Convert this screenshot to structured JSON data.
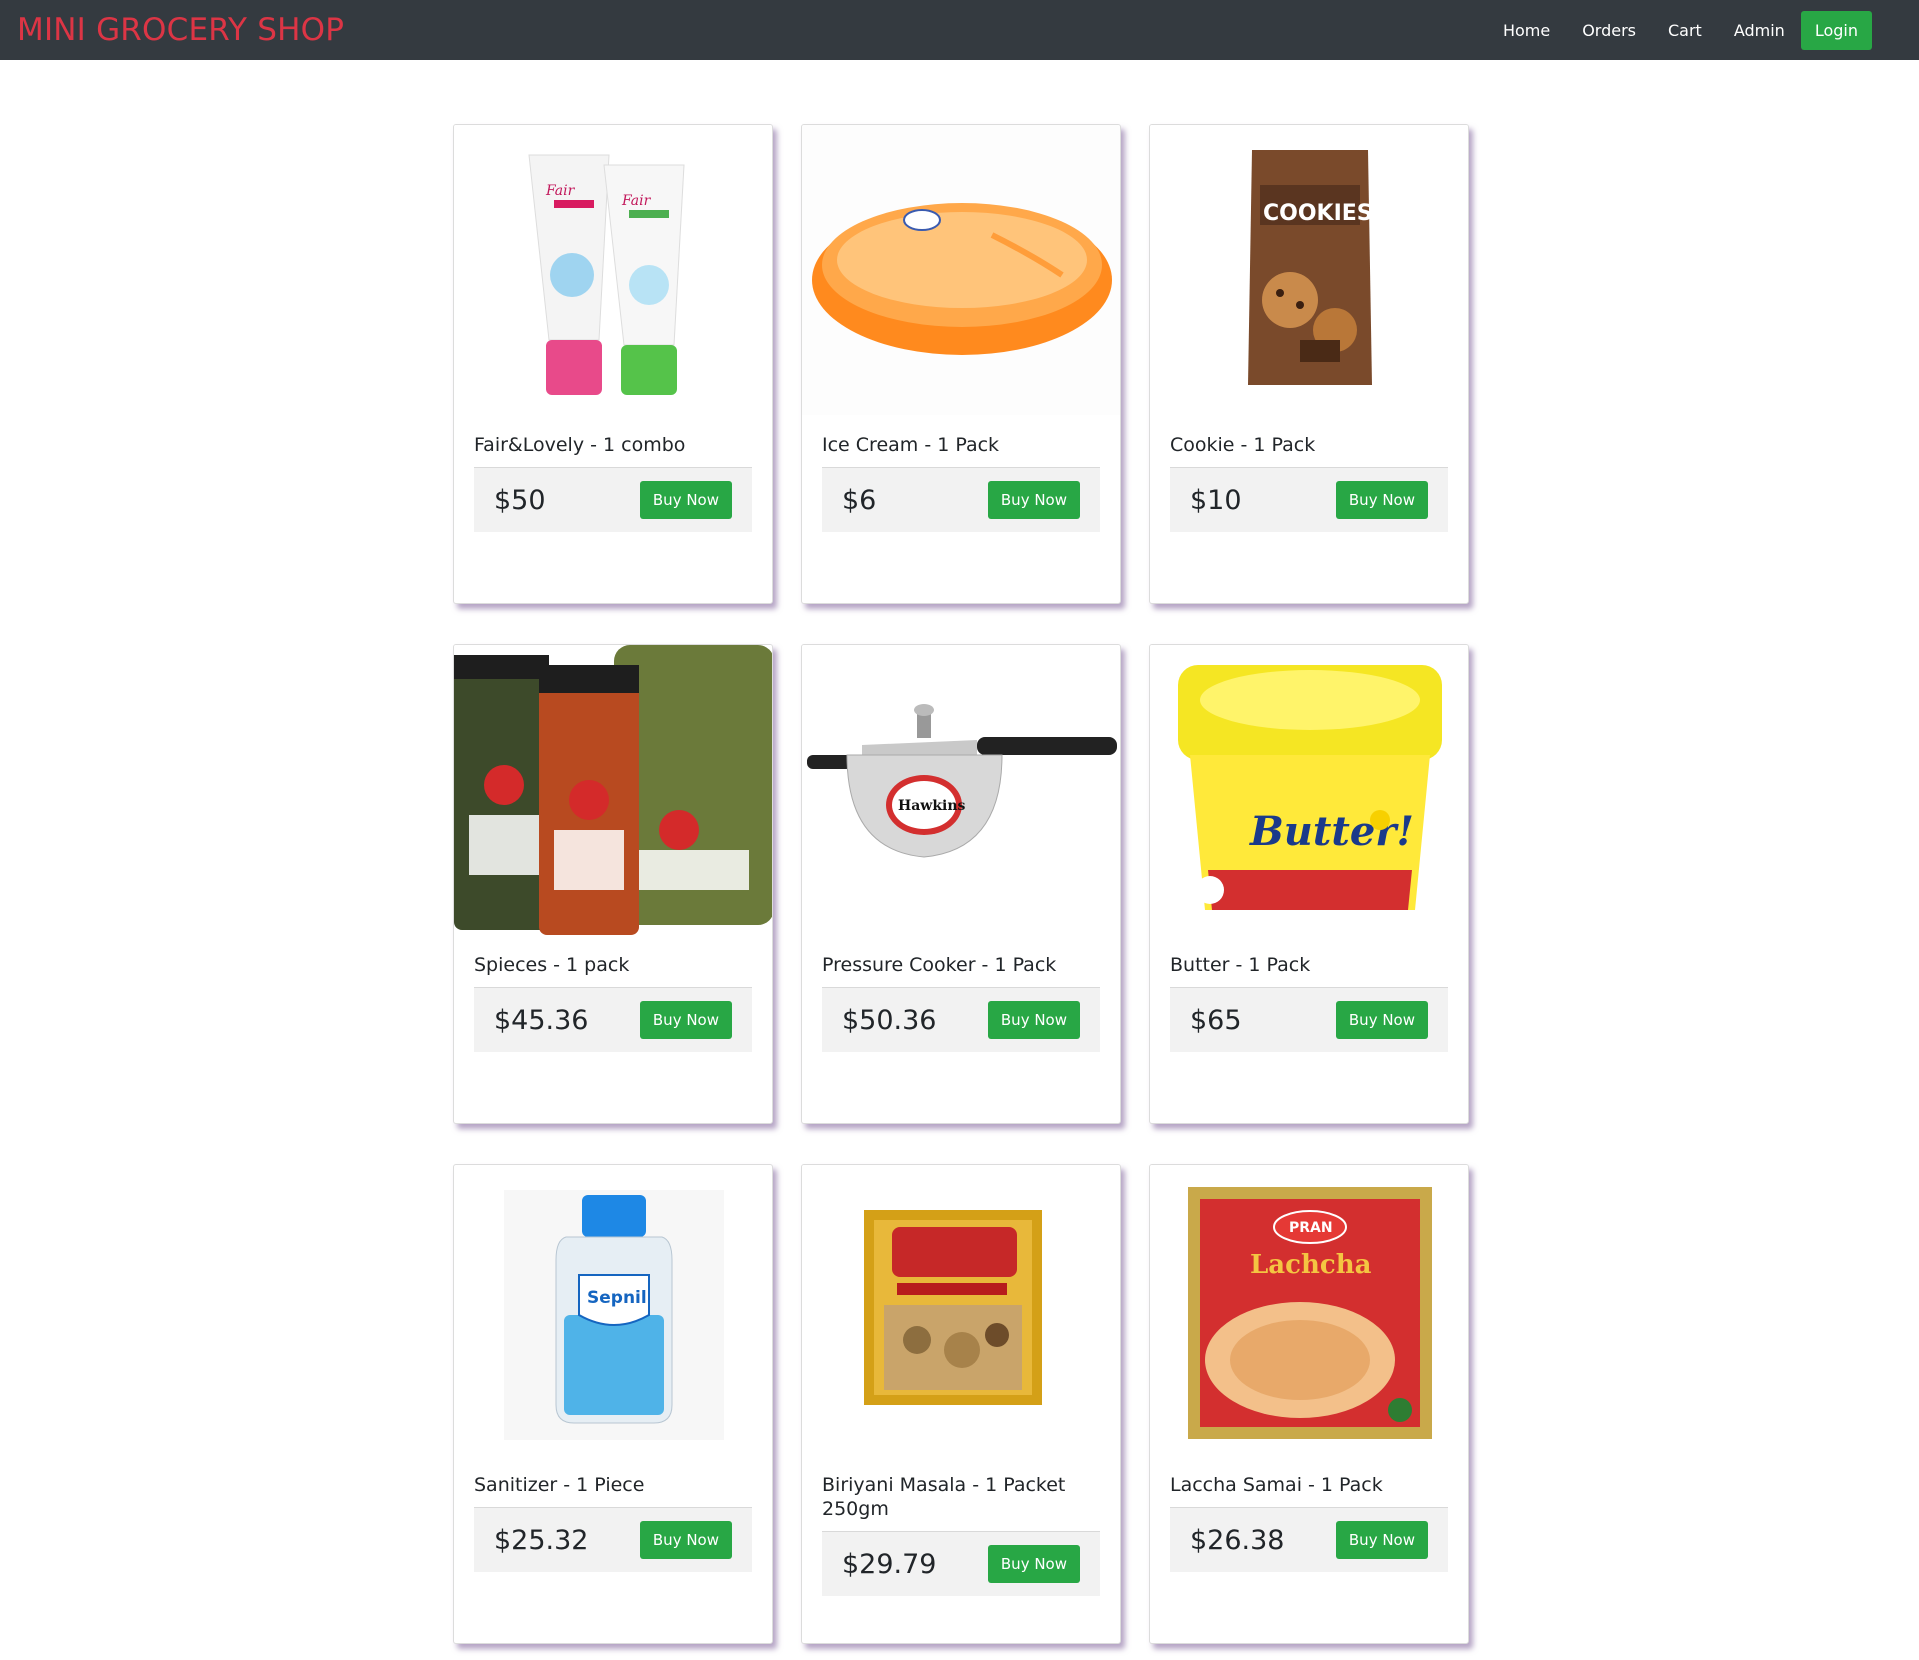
{
  "navbar": {
    "brand": "MINI GROCERY SHOP",
    "links": [
      "Home",
      "Orders",
      "Cart",
      "Admin"
    ],
    "login_label": "Login"
  },
  "colors": {
    "brand": "#dc3545",
    "navbar_bg": "#343a40",
    "button_green": "#28a745"
  },
  "buy_label": "Buy Now",
  "products": [
    {
      "title": "Fair&Lovely - 1 combo",
      "price": "$50",
      "image": "face-wash-tubes"
    },
    {
      "title": "Ice Cream - 1 Pack",
      "price": "$6",
      "image": "ice-cream-tub"
    },
    {
      "title": "Cookie - 1 Pack",
      "price": "$10",
      "image": "cookie-pack"
    },
    {
      "title": "Spieces - 1 pack",
      "price": "$45.36",
      "image": "spice-jars"
    },
    {
      "title": "Pressure Cooker - 1 Pack",
      "price": "$50.36",
      "image": "pressure-cooker"
    },
    {
      "title": "Butter - 1 Pack",
      "price": "$65",
      "image": "butter-tub"
    },
    {
      "title": "Sanitizer - 1 Piece",
      "price": "$25.32",
      "image": "sanitizer-bottle"
    },
    {
      "title": "Biriyani Masala - 1 Packet 250gm",
      "price": "$29.79",
      "image": "masala-box"
    },
    {
      "title": "Laccha Samai - 1 Pack",
      "price": "$26.38",
      "image": "samai-pack"
    }
  ],
  "image_text": {
    "cookie_brand": "COOKIES",
    "cooker_brand": "Hawkins",
    "butter_brand": "Butter!",
    "sanitizer_brand": "Sepnil",
    "samai_brand": "Lachcha",
    "pran": "PRAN"
  }
}
